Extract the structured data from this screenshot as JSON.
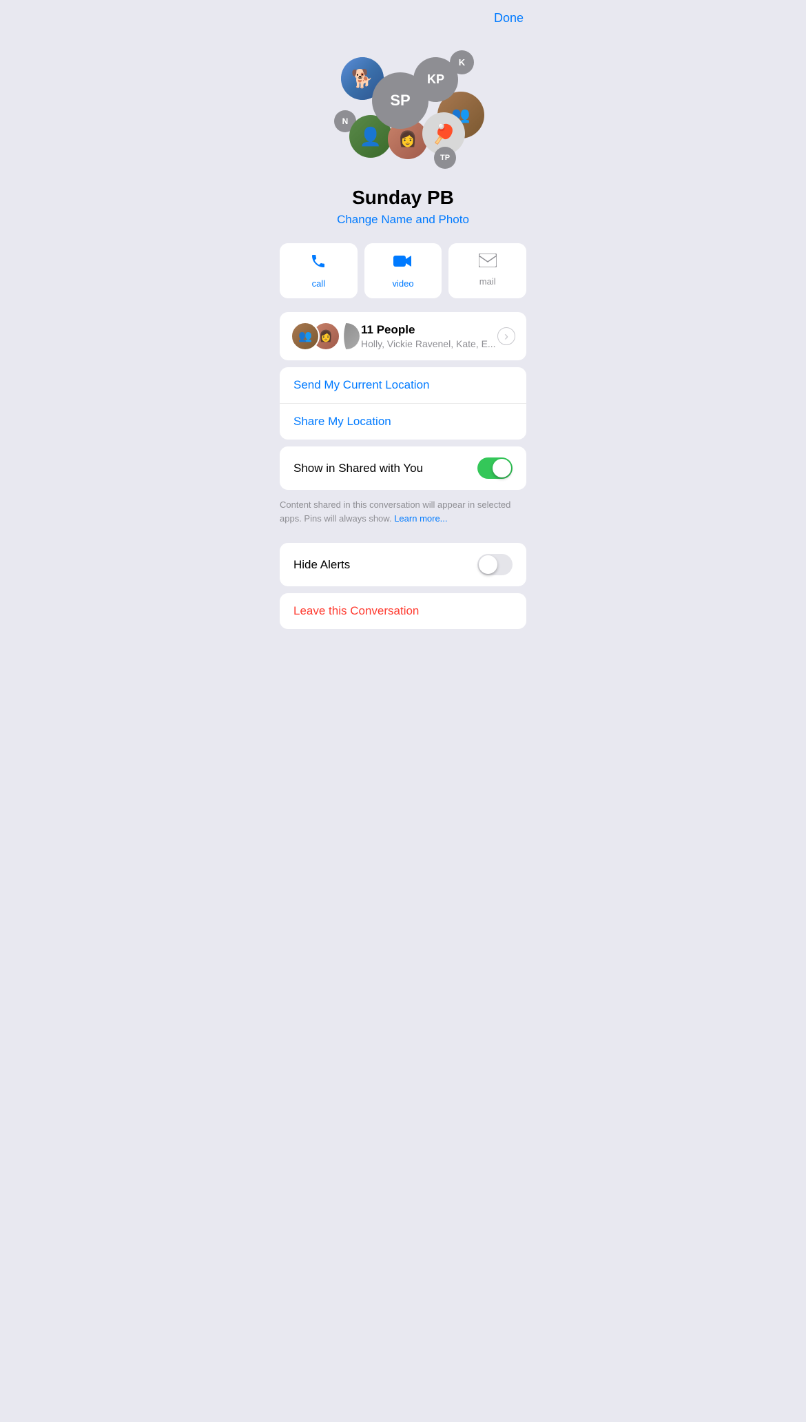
{
  "header": {
    "done_label": "Done"
  },
  "group": {
    "name": "Sunday PB",
    "change_label": "Change Name and Photo",
    "avatar_initials": {
      "sp": "SP",
      "kp": "KP",
      "k": "K",
      "n": "N",
      "tp": "TP"
    },
    "avatar_emojis": {
      "dog": "🐶",
      "pingpong": "🏓"
    }
  },
  "actions": {
    "call_label": "call",
    "video_label": "video",
    "mail_label": "mail"
  },
  "people": {
    "count_label": "11 People",
    "names_preview": "Holly, Vickie Ravenel, Kate, E..."
  },
  "location": {
    "send_label": "Send My Current Location",
    "share_label": "Share My Location"
  },
  "shared_with_you": {
    "label": "Show in Shared with You",
    "toggle_state": "on",
    "description": "Content shared in this conversation will appear in selected apps. Pins will always show.",
    "learn_more_label": "Learn more..."
  },
  "hide_alerts": {
    "label": "Hide Alerts",
    "toggle_state": "off"
  },
  "leave": {
    "label": "Leave this Conversation"
  }
}
